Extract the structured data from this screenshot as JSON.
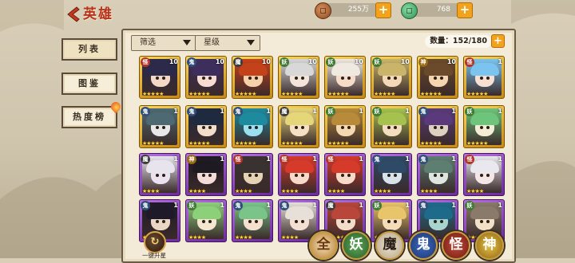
{
  "header": {
    "title": "英雄",
    "coins": "255万",
    "jade": "768",
    "plus": "+"
  },
  "tabs": [
    {
      "label": "列表",
      "active": true
    },
    {
      "label": "图鉴",
      "active": false
    },
    {
      "label": "热度榜",
      "active": false,
      "has_hot_badge": true
    }
  ],
  "filters": {
    "filter_label": "筛选",
    "star_label": "星级"
  },
  "capacity": {
    "text": "数量：152/180",
    "plus": "+"
  },
  "heroes": [
    {
      "faction": "怪",
      "level": "10",
      "stars": 5,
      "frame": "gold",
      "hair": "#2b2a4a",
      "face": "#f3d9c5"
    },
    {
      "faction": "鬼",
      "level": "10",
      "stars": 5,
      "frame": "gold",
      "hair": "#3d2e5e",
      "face": "#f7dcd2"
    },
    {
      "faction": "魔",
      "level": "10",
      "stars": 5,
      "frame": "gold",
      "hair": "#c4421a",
      "face": "#f5d0a8"
    },
    {
      "faction": "妖",
      "level": "10",
      "stars": 5,
      "frame": "gold",
      "hair": "#d8d8d8",
      "face": "#f3e5d9"
    },
    {
      "faction": "妖",
      "level": "10",
      "stars": 5,
      "frame": "gold",
      "hair": "#efe9e0",
      "face": "#f6dcc8"
    },
    {
      "faction": "妖",
      "level": "10",
      "stars": 5,
      "frame": "gold",
      "hair": "#c9b46a",
      "face": "#f5d8b8"
    },
    {
      "faction": "神",
      "level": "10",
      "stars": 5,
      "frame": "gold",
      "hair": "#6a4a2a",
      "face": "#f5d5b0"
    },
    {
      "faction": "怪",
      "level": "1",
      "stars": 5,
      "frame": "gold",
      "hair": "#7ac4ef",
      "face": "#f7e0d2"
    },
    {
      "faction": "鬼",
      "level": "1",
      "stars": 5,
      "frame": "gold",
      "hair": "#4d6a72",
      "face": "#e8e8e8"
    },
    {
      "faction": "鬼",
      "level": "1",
      "stars": 5,
      "frame": "gold",
      "hair": "#1e2a40",
      "face": "#f3dcc8"
    },
    {
      "faction": "鬼",
      "level": "1",
      "stars": 5,
      "frame": "gold",
      "hair": "#1e8a9e",
      "face": "#9be0ef"
    },
    {
      "faction": "魔",
      "level": "1",
      "stars": 5,
      "frame": "gold",
      "hair": "#e6d67a",
      "face": "#f5e0c6"
    },
    {
      "faction": "妖",
      "level": "1",
      "stars": 5,
      "frame": "gold",
      "hair": "#b88b3a",
      "face": "#f5d8b0"
    },
    {
      "faction": "妖",
      "level": "1",
      "stars": 5,
      "frame": "gold",
      "hair": "#a6c24e",
      "face": "#f3dcc0"
    },
    {
      "faction": "鬼",
      "level": "1",
      "stars": 5,
      "frame": "gold",
      "hair": "#5a3a7a",
      "face": "#dcd0c0"
    },
    {
      "faction": "妖",
      "level": "1",
      "stars": 5,
      "frame": "gold",
      "hair": "#6ec47a",
      "face": "#f5ecd8"
    },
    {
      "faction": "魔",
      "level": "1",
      "stars": 4,
      "frame": "purple",
      "hair": "#e8e4ee",
      "face": "#eae2ee"
    },
    {
      "faction": "神",
      "level": "1",
      "stars": 4,
      "frame": "purple",
      "hair": "#1e1a22",
      "face": "#f3dcd8"
    },
    {
      "faction": "怪",
      "level": "1",
      "stars": 4,
      "frame": "purple",
      "hair": "#3a3230",
      "face": "#e6d3b4"
    },
    {
      "faction": "怪",
      "level": "1",
      "stars": 4,
      "frame": "purple",
      "hair": "#d63a2a",
      "face": "#f6dcc8"
    },
    {
      "faction": "怪",
      "level": "1",
      "stars": 4,
      "frame": "purple",
      "hair": "#d63a2a",
      "face": "#f6dcc8"
    },
    {
      "faction": "鬼",
      "level": "1",
      "stars": 4,
      "frame": "purple",
      "hair": "#2e4a66",
      "face": "#d8e2ea"
    },
    {
      "faction": "鬼",
      "level": "1",
      "stars": 4,
      "frame": "purple",
      "hair": "#5e7e72",
      "face": "#dfe6e2"
    },
    {
      "faction": "怪",
      "level": "1",
      "stars": 4,
      "frame": "purple",
      "hair": "#e8e8ee",
      "face": "#f5e6e6"
    },
    {
      "faction": "鬼",
      "level": "1",
      "stars": 4,
      "frame": "purple",
      "hair": "#1e1a2a",
      "face": "#ebd6c4"
    },
    {
      "faction": "妖",
      "level": "1",
      "stars": 4,
      "frame": "purple",
      "hair": "#8cd07a",
      "face": "#f5e6d0"
    },
    {
      "faction": "鬼",
      "level": "1",
      "stars": 4,
      "frame": "purple",
      "hair": "#7ac48a",
      "face": "#f5e0d0"
    },
    {
      "faction": "鬼",
      "level": "1",
      "stars": 4,
      "frame": "purple",
      "hair": "#e6e0d8",
      "face": "#f3e0d0"
    },
    {
      "faction": "魔",
      "level": "1",
      "stars": 4,
      "frame": "purple",
      "hair": "#b8463a",
      "face": "#f3dcc8"
    },
    {
      "faction": "妖",
      "level": "1",
      "stars": 4,
      "frame": "purple",
      "hair": "#e8c46a",
      "face": "#f5dcb8"
    },
    {
      "faction": "鬼",
      "level": "1",
      "stars": 4,
      "frame": "purple",
      "hair": "#1e6a8a",
      "face": "#a8d4d0"
    },
    {
      "faction": "妖",
      "level": "1",
      "stars": 4,
      "frame": "purple",
      "hair": "#8a7a6a",
      "face": "#f3e0c8"
    }
  ],
  "bottom": {
    "one_key_label": "一键升星",
    "factions": [
      "全",
      "妖",
      "魔",
      "鬼",
      "怪",
      "神"
    ]
  },
  "colors": {
    "title_red": "#b8331f",
    "plus_orange": "#f2a21b",
    "faction_tag": {
      "怪": "#b0342a",
      "鬼": "#2f4f7a",
      "魔": "#3b3b3b",
      "妖": "#3f7a34",
      "神": "#9a6a12"
    }
  }
}
